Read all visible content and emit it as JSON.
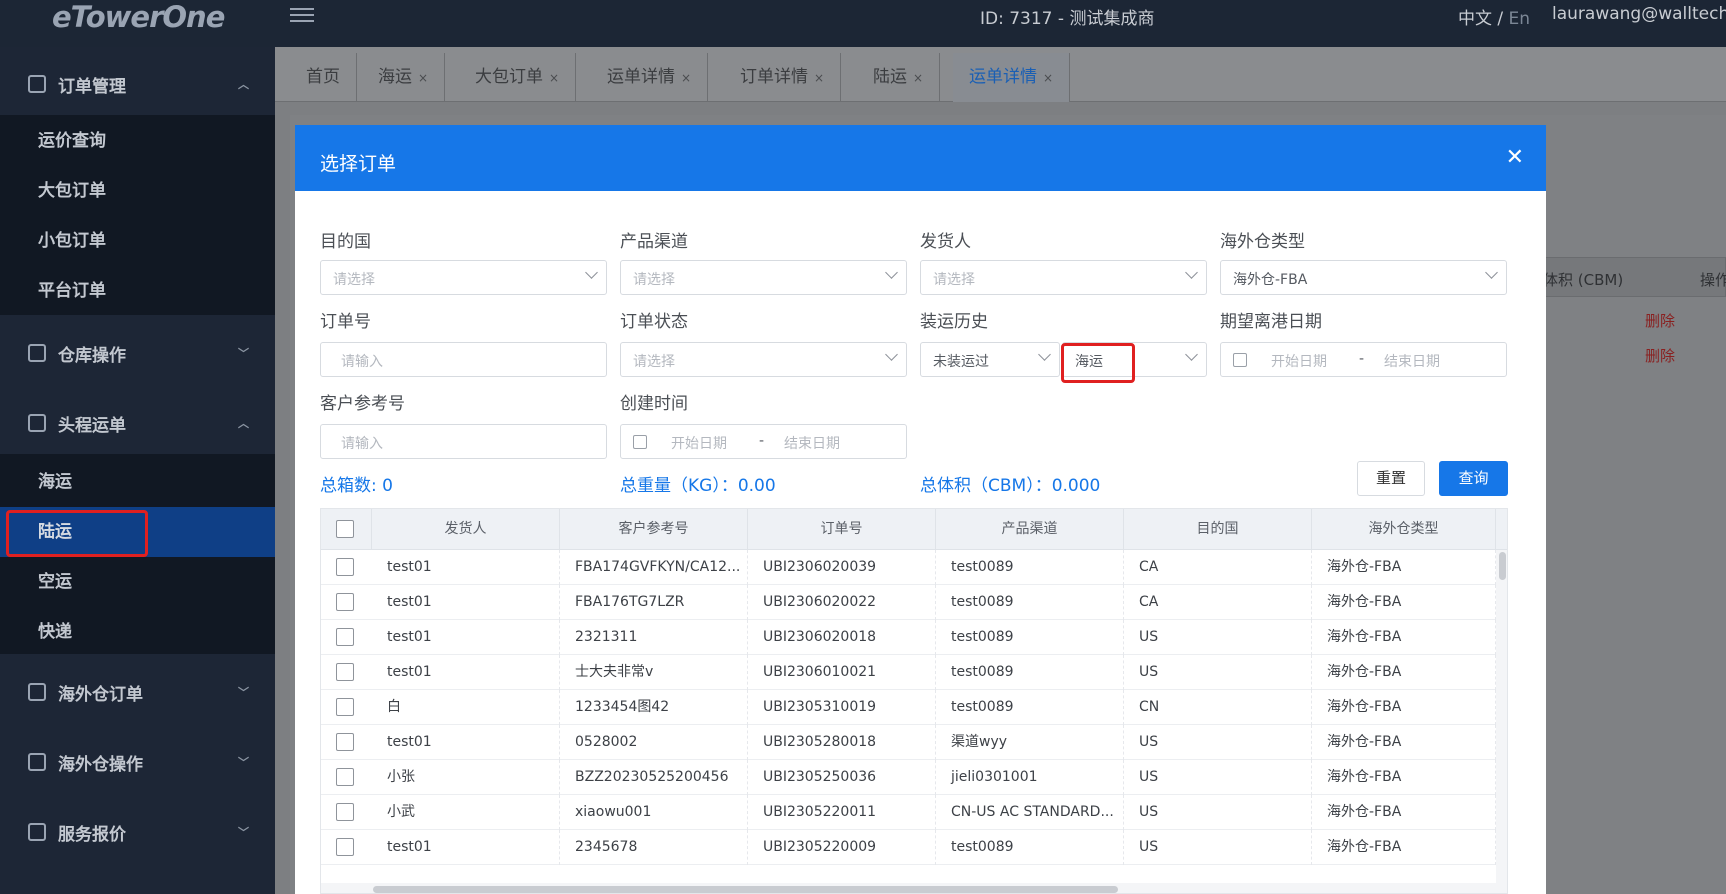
{
  "topbar": {
    "logo": "eTowerOne",
    "id_text": "ID: 7317 - 测试集成商",
    "lang_zh": "中文",
    "lang_sep": " / ",
    "lang_en": "En",
    "user": "laurawang@walltechsy"
  },
  "sidebar": {
    "groups": [
      {
        "label": "订单管理",
        "icon": "order-icon"
      },
      {
        "label": "仓库操作",
        "icon": "warehouse-icon"
      },
      {
        "label": "头程运单",
        "icon": "shipment-icon"
      },
      {
        "label": "海外仓订单",
        "icon": "overseas-order-icon"
      },
      {
        "label": "海外仓操作",
        "icon": "overseas-ops-icon"
      },
      {
        "label": "服务报价",
        "icon": "quote-icon"
      }
    ],
    "order_items": [
      "运价查询",
      "大包订单",
      "小包订单",
      "平台订单"
    ],
    "shipment_items": [
      "海运",
      "陆运",
      "空运",
      "快递"
    ],
    "active_item": "陆运"
  },
  "tabs": [
    {
      "label": "首页"
    },
    {
      "label": "海运"
    },
    {
      "label": "大包订单"
    },
    {
      "label": "运单详情"
    },
    {
      "label": "订单详情"
    },
    {
      "label": "陆运"
    },
    {
      "label": "运单详情",
      "active": true
    }
  ],
  "background": {
    "col_header_1": "体积 (CBM)",
    "col_header_2": "操作",
    "delete_label": "删除"
  },
  "modal": {
    "title": "选择订单",
    "fields": {
      "dest_country": {
        "label": "目的国",
        "placeholder": "请选择"
      },
      "product_channel": {
        "label": "产品渠道",
        "placeholder": "请选择"
      },
      "shipper": {
        "label": "发货人",
        "placeholder": "请选择"
      },
      "warehouse_type": {
        "label": "海外仓类型",
        "value": "海外仓-FBA"
      },
      "order_no": {
        "label": "订单号",
        "placeholder": "请输入"
      },
      "order_status": {
        "label": "订单状态",
        "placeholder": "请选择"
      },
      "ship_history": {
        "label": "装运历史",
        "value1": "未装运过",
        "value2": "海运"
      },
      "departure_date": {
        "label": "期望离港日期",
        "start": "开始日期",
        "end": "结束日期",
        "sep": "-"
      },
      "customer_ref": {
        "label": "客户参考号",
        "placeholder": "请输入"
      },
      "created_time": {
        "label": "创建时间",
        "start": "开始日期",
        "end": "结束日期",
        "sep": "-"
      }
    },
    "stats": {
      "total_boxes": "总箱数:  0",
      "total_weight": "总重量（KG）：0.00",
      "total_volume": "总体积（CBM）：0.000"
    },
    "buttons": {
      "reset": "重置",
      "query": "查询"
    },
    "table": {
      "columns": [
        "发货人",
        "客户参考号",
        "订单号",
        "产品渠道",
        "目的国",
        "海外仓类型"
      ],
      "rows": [
        [
          "test01",
          "FBA174GVFKYN/CA12...",
          "UBI2306020039",
          "test0089",
          "CA",
          "海外仓-FBA"
        ],
        [
          "test01",
          "FBA176TG7LZR",
          "UBI2306020022",
          "test0089",
          "CA",
          "海外仓-FBA"
        ],
        [
          "test01",
          "2321311",
          "UBI2306020018",
          "test0089",
          "US",
          "海外仓-FBA"
        ],
        [
          "test01",
          "士大夫非常v",
          "UBI2306010021",
          "test0089",
          "US",
          "海外仓-FBA"
        ],
        [
          "白",
          "1233454图42",
          "UBI2305310019",
          "test0089",
          "CN",
          "海外仓-FBA"
        ],
        [
          "test01",
          "0528002",
          "UBI2305280018",
          "渠道wyy",
          "US",
          "海外仓-FBA"
        ],
        [
          "小张",
          "BZZ20230525200456",
          "UBI2305250036",
          "jieli0301001",
          "US",
          "海外仓-FBA"
        ],
        [
          "小武",
          "xiaowu001",
          "UBI2305220011",
          "CN-US AC STANDARD...",
          "US",
          "海外仓-FBA"
        ],
        [
          "test01",
          "2345678",
          "UBI2305220009",
          "test0089",
          "US",
          "海外仓-FBA"
        ]
      ]
    }
  }
}
